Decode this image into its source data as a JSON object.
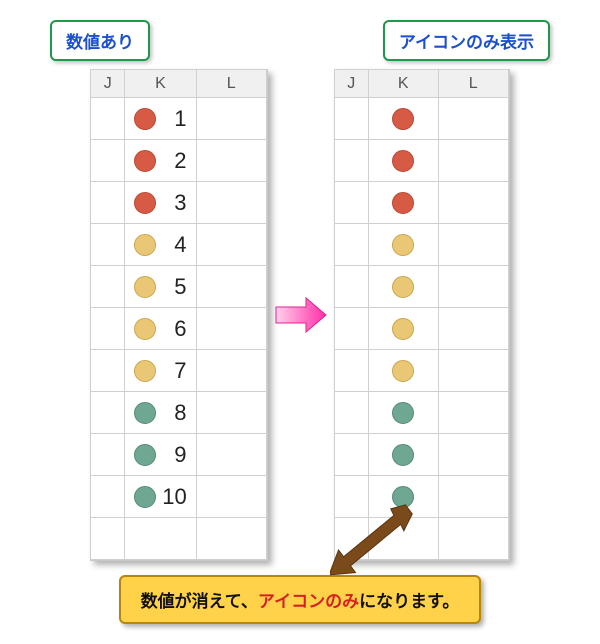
{
  "labels": {
    "left": "数値あり",
    "right": "アイコンのみ表示"
  },
  "columns": [
    "J",
    "K",
    "L"
  ],
  "rows": [
    {
      "value": 1,
      "color": "red"
    },
    {
      "value": 2,
      "color": "red"
    },
    {
      "value": 3,
      "color": "red"
    },
    {
      "value": 4,
      "color": "yellow"
    },
    {
      "value": 5,
      "color": "yellow"
    },
    {
      "value": 6,
      "color": "yellow"
    },
    {
      "value": 7,
      "color": "yellow"
    },
    {
      "value": 8,
      "color": "green"
    },
    {
      "value": 9,
      "color": "green"
    },
    {
      "value": 10,
      "color": "green"
    }
  ],
  "caption": {
    "pre": "数値が消えて、",
    "highlight": "アイコンのみ",
    "post": "になります。"
  },
  "chart_data": {
    "type": "table",
    "left_table": {
      "columns": [
        "J",
        "K",
        "L"
      ],
      "K_values": [
        1,
        2,
        3,
        4,
        5,
        6,
        7,
        8,
        9,
        10
      ],
      "K_icon_colors": [
        "red",
        "red",
        "red",
        "yellow",
        "yellow",
        "yellow",
        "yellow",
        "green",
        "green",
        "green"
      ]
    },
    "right_table": {
      "columns": [
        "J",
        "K",
        "L"
      ],
      "K_values": [
        null,
        null,
        null,
        null,
        null,
        null,
        null,
        null,
        null,
        null
      ],
      "K_icon_colors": [
        "red",
        "red",
        "red",
        "yellow",
        "yellow",
        "yellow",
        "yellow",
        "green",
        "green",
        "green"
      ]
    }
  }
}
